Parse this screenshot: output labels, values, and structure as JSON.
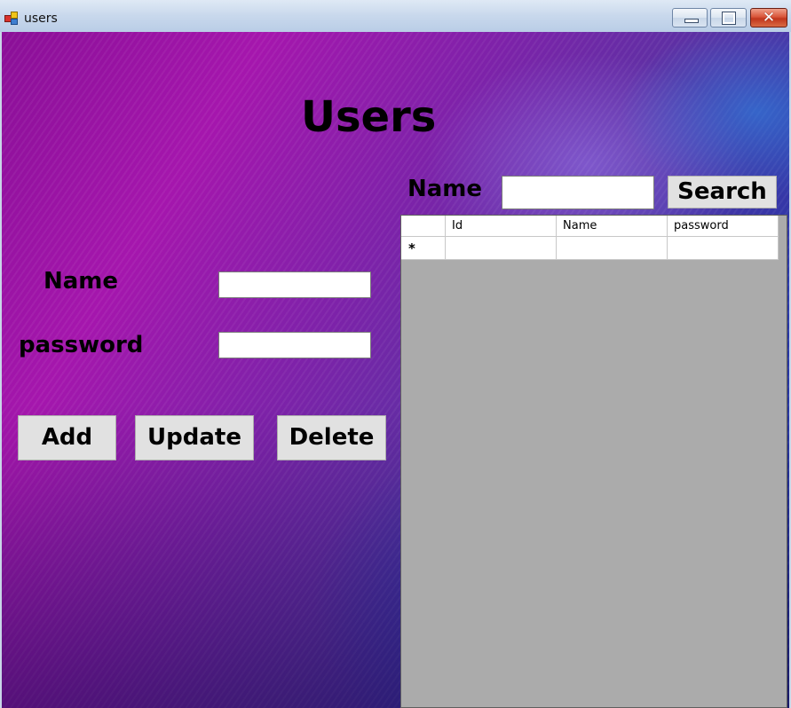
{
  "window": {
    "title": "users",
    "min_icon": "minimize-icon",
    "max_icon": "maximize-icon",
    "close_icon": "close-icon",
    "close_glyph": "✕"
  },
  "form": {
    "title": "Users",
    "name_label": "Name",
    "name_value": "",
    "password_label": "password",
    "password_value": ""
  },
  "actions": {
    "add_label": "Add",
    "update_label": "Update",
    "delete_label": "Delete"
  },
  "search": {
    "label": "Name",
    "value": "",
    "button_label": "Search"
  },
  "grid": {
    "columns": [
      "Id",
      "Name",
      "password"
    ],
    "new_row_marker": "*",
    "rows": []
  },
  "colors": {
    "button_face": "#e1e1e1",
    "grid_background": "#ababab",
    "background_purple": "#a516ad",
    "background_blue": "#1a2a8a"
  }
}
